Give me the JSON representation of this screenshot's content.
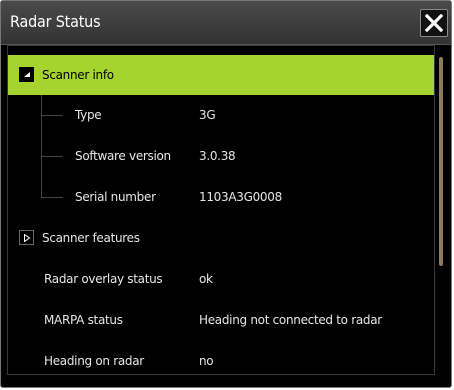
{
  "dialog": {
    "title": "Radar Status"
  },
  "tree": {
    "scanner_info": {
      "label": "Scanner info",
      "expanded": true,
      "children": [
        {
          "label": "Type",
          "value": "3G"
        },
        {
          "label": "Software version",
          "value": "3.0.38"
        },
        {
          "label": "Serial number",
          "value": "1103A3G0008"
        }
      ]
    },
    "scanner_features": {
      "label": "Scanner features",
      "expanded": false
    },
    "rows": [
      {
        "label": "Radar overlay status",
        "value": "ok"
      },
      {
        "label": "MARPA status",
        "value": "Heading not connected to radar"
      },
      {
        "label": "Heading on radar",
        "value": "no"
      }
    ]
  },
  "colors": {
    "selection": "#a6d32d",
    "background": "#000000",
    "scrollbar": "#8c7a5a"
  },
  "icons": {
    "close": "close-icon",
    "expanded": "triangle-down-icon",
    "collapsed": "triangle-right-icon"
  }
}
